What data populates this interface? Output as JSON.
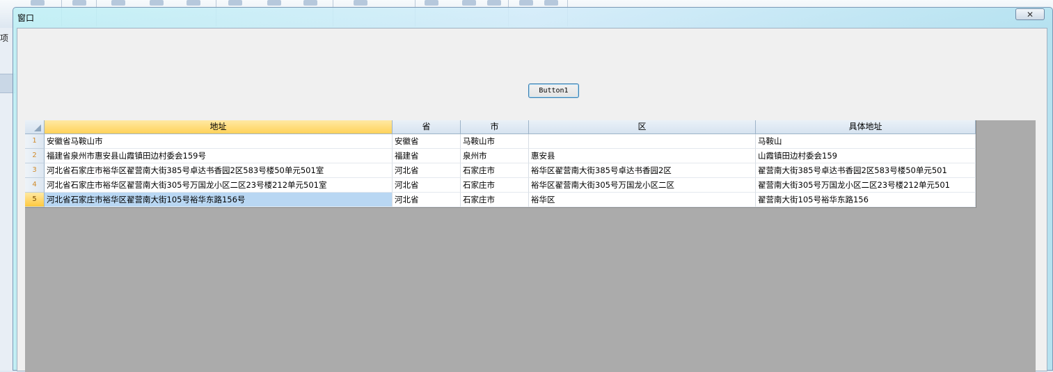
{
  "background": {
    "left_text": "项"
  },
  "window": {
    "title": "窗口",
    "close_glyph": "✕",
    "button1_label": "Button1"
  },
  "grid": {
    "columns": [
      "地址",
      "省",
      "市",
      "区",
      "具体地址"
    ],
    "rows": [
      {
        "num": "1",
        "cells": [
          "安徽省马鞍山市",
          "安徽省",
          "马鞍山市",
          "",
          "马鞍山"
        ]
      },
      {
        "num": "2",
        "cells": [
          "福建省泉州市惠安县山霞镇田边村委会159号",
          "福建省",
          "泉州市",
          "惠安县",
          "山霞镇田边村委会159"
        ]
      },
      {
        "num": "3",
        "cells": [
          "河北省石家庄市裕华区翟营南大街385号卓达书香园2区583号楼50单元501室",
          "河北省",
          "石家庄市",
          "裕华区翟营南大街385号卓达书香园2区",
          "翟营南大街385号卓达书香园2区583号楼50单元501"
        ]
      },
      {
        "num": "4",
        "cells": [
          "河北省石家庄市裕华区翟营南大街305号万国龙小区二区23号楼212单元501室",
          "河北省",
          "石家庄市",
          "裕华区翟营南大街305号万国龙小区二区",
          "翟营南大街305号万国龙小区二区23号楼212单元501"
        ]
      },
      {
        "num": "5",
        "cells": [
          "河北省石家庄市裕华区翟营南大街105号裕华东路156号",
          "河北省",
          "石家庄市",
          "裕华区",
          "翟营南大街105号裕华东路156"
        ]
      }
    ],
    "selected_row": 4
  },
  "colors": {
    "header_active": "#ffd25a",
    "selection": "#b9d7f3",
    "grid_empty": "#ababab"
  }
}
